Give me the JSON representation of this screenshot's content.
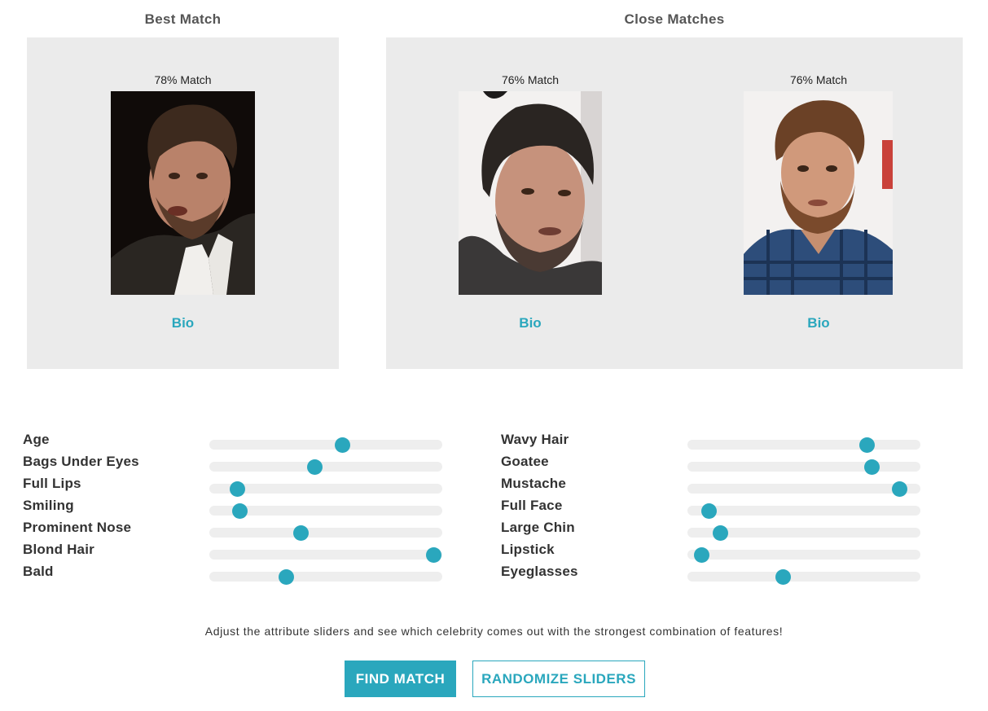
{
  "best_match": {
    "title": "Best Match",
    "card": {
      "percent_label": "78% Match",
      "photo_icon": "portrait-photo-1",
      "bio_label": "Bio"
    }
  },
  "close_matches": {
    "title": "Close Matches",
    "cards": [
      {
        "percent_label": "76% Match",
        "photo_icon": "portrait-photo-2",
        "bio_label": "Bio"
      },
      {
        "percent_label": "76% Match",
        "photo_icon": "portrait-photo-3",
        "bio_label": "Bio"
      }
    ]
  },
  "sliders": {
    "left": [
      {
        "label": "Age",
        "value": 0.57
      },
      {
        "label": "Bags Under Eyes",
        "value": 0.45
      },
      {
        "label": "Full Lips",
        "value": 0.12
      },
      {
        "label": "Smiling",
        "value": 0.13
      },
      {
        "label": "Prominent Nose",
        "value": 0.39
      },
      {
        "label": "Blond Hair",
        "value": 0.96
      },
      {
        "label": "Bald",
        "value": 0.33
      }
    ],
    "right": [
      {
        "label": "Wavy Hair",
        "value": 0.77
      },
      {
        "label": "Goatee",
        "value": 0.79
      },
      {
        "label": "Mustache",
        "value": 0.91
      },
      {
        "label": "Full Face",
        "value": 0.09
      },
      {
        "label": "Large Chin",
        "value": 0.14
      },
      {
        "label": "Lipstick",
        "value": 0.06
      },
      {
        "label": "Eyeglasses",
        "value": 0.41
      }
    ]
  },
  "instructions": "Adjust the attribute sliders and see which celebrity comes out with the strongest combination of features!",
  "buttons": {
    "find_label": "FIND MATCH",
    "randomize_label": "RANDOMIZE SLIDERS"
  },
  "colors": {
    "accent": "#2aa7bd",
    "panel_bg": "#ebebeb",
    "track_bg": "#eeeeee"
  }
}
